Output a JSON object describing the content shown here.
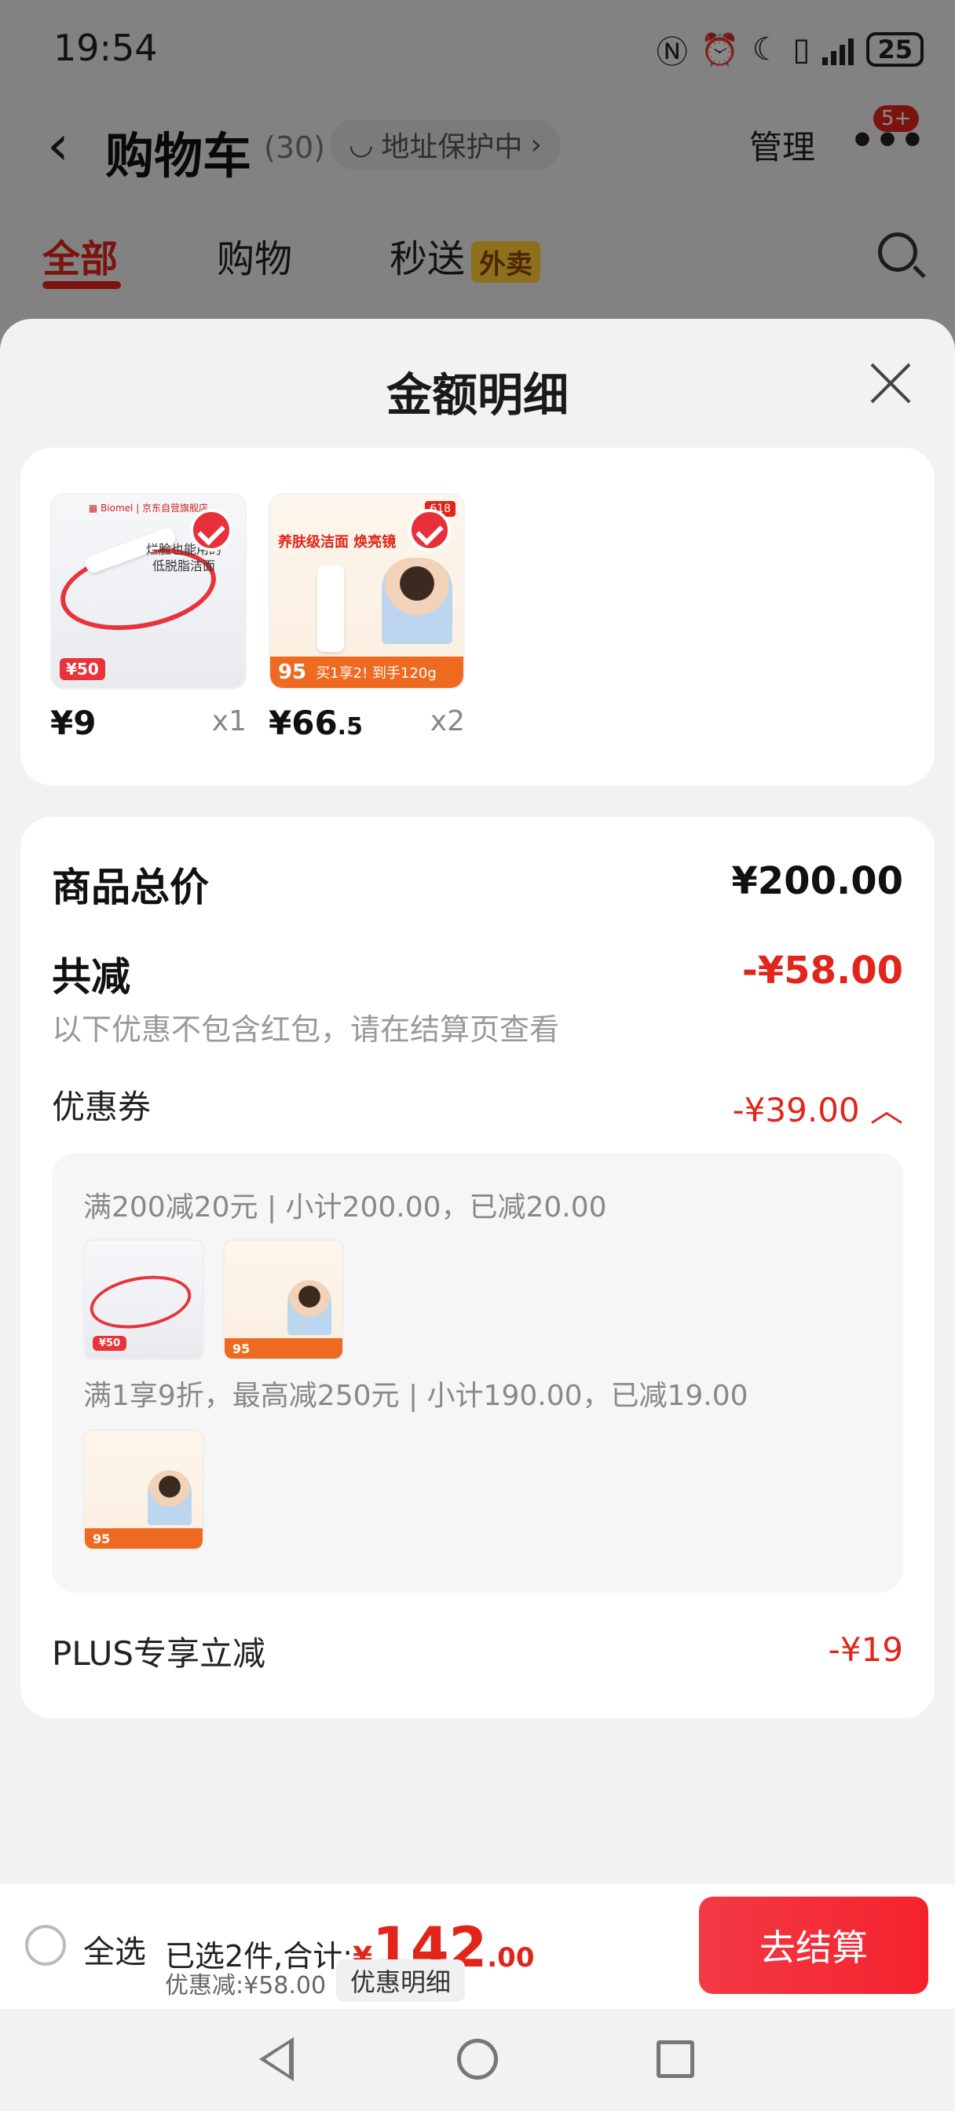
{
  "status_bar": {
    "time": "19:54",
    "battery": "25",
    "icons": [
      "nfc-icon",
      "alarm-icon",
      "moon-icon",
      "vibrate-icon",
      "signal-icon",
      "battery-icon"
    ]
  },
  "cart_header": {
    "title": "购物车",
    "count": "(30)",
    "address_chip": "地址保护中",
    "manage": "管理",
    "badge": "5+"
  },
  "tabs": [
    {
      "label": "全部",
      "active": true
    },
    {
      "label": "购物",
      "active": false
    },
    {
      "label": "秒送",
      "badge": "外卖",
      "active": false
    }
  ],
  "sheet": {
    "title": "金额明细",
    "products": [
      {
        "price": "¥9",
        "price_small": "",
        "qty": "x1",
        "img_text": "烂脸也能用的\n低脱脂洁面",
        "img_tag": "¥50"
      },
      {
        "price": "¥66",
        "price_small": ".5",
        "qty": "x2",
        "img_head": "养肤级洁面 焕亮镜",
        "img_badge": "618",
        "img_strip_big": "95",
        "img_strip": "买1享2! 到手120g"
      }
    ],
    "total_label": "商品总价",
    "total_value": "¥200.00",
    "reduce_label": "共减",
    "reduce_value": "-¥58.00",
    "reduce_note": "以下优惠不包含红包，请在结算页查看",
    "coupon_label": "优惠券",
    "coupon_value": "-¥39.00 ︿",
    "coupon_rules": [
      "满200减20元 | 小计200.00，已减20.00",
      "满1享9折，最高减250元 | 小计190.00，已减19.00"
    ],
    "plus_label": "PLUS专享立减",
    "plus_value": "-¥19"
  },
  "bottom_bar": {
    "select_all": "全选",
    "selected_text": "已选2件,合计:",
    "currency": "¥",
    "total_int": "142",
    "total_dec": ".00",
    "discount": "优惠减:¥58.00",
    "detail_chip": "优惠明细",
    "checkout": "去结算"
  },
  "colors": {
    "accent": "#e1251b",
    "checkout": "#f5222d",
    "sheet_bg": "#f2f2f2"
  }
}
